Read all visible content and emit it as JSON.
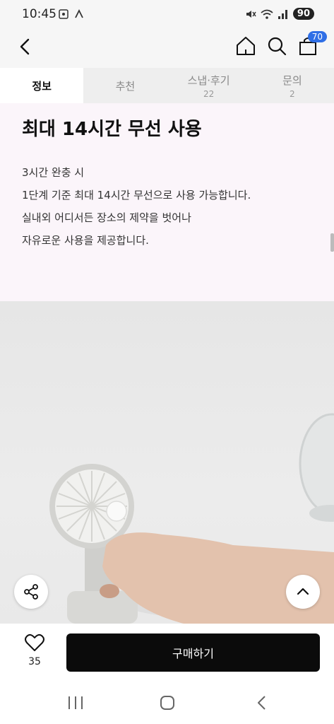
{
  "status": {
    "time": "10:45",
    "battery": "90",
    "left_icons": [
      "screenshot-icon",
      "gesture-icon"
    ],
    "right_icons": [
      "mute-icon",
      "wifi-icon",
      "signal-icon"
    ]
  },
  "header": {
    "cart_count": "70",
    "icons": [
      "back-icon",
      "home-icon",
      "search-icon",
      "cart-icon"
    ]
  },
  "tabs": [
    {
      "label": "정보",
      "count": "",
      "active": true
    },
    {
      "label": "추천",
      "count": "",
      "active": false
    },
    {
      "label": "스냅·후기",
      "count": "22",
      "active": false
    },
    {
      "label": "문의",
      "count": "2",
      "active": false
    }
  ],
  "content": {
    "heading": "최대 14시간 무선 사용",
    "lines": [
      "3시간 완충 시",
      "1단계 기준 최대 14시간 무선으로 사용 가능합니다.",
      "실내외 어디서든 장소의 제약을 벗어나",
      "자유로운 사용을 제공합니다."
    ]
  },
  "bottom": {
    "like_count": "35",
    "buy_label": "구매하기"
  },
  "colors": {
    "accent": "#2f6fe6",
    "buy_button": "#0b0b0b",
    "content_bg": "#fbf5fa"
  }
}
